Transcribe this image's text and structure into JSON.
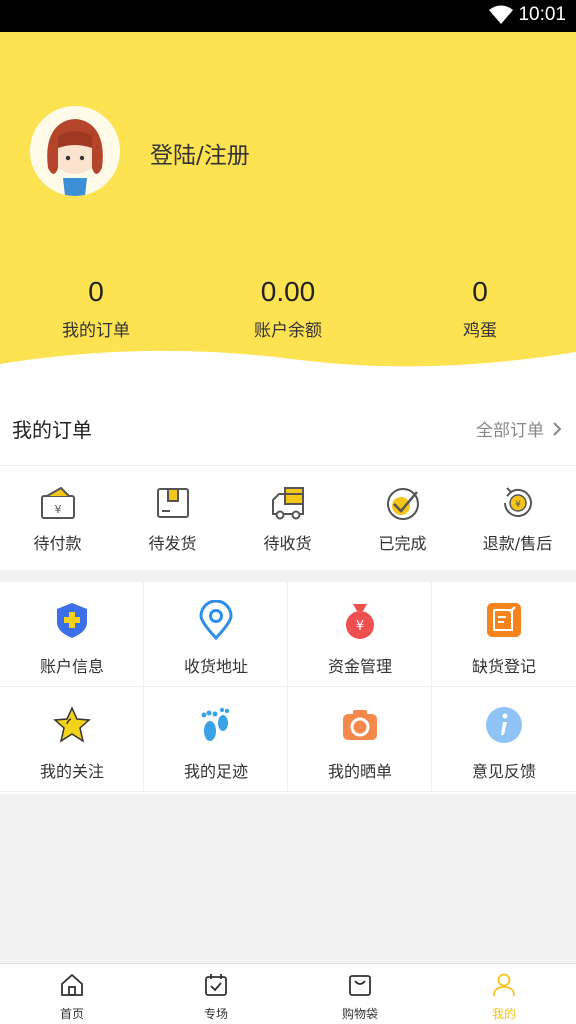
{
  "status_bar": {
    "time": "10:01"
  },
  "profile": {
    "login_label": "登陆/注册"
  },
  "stats": [
    {
      "value": "0",
      "label": "我的订单"
    },
    {
      "value": "0.00",
      "label": "账户余额"
    },
    {
      "value": "0",
      "label": "鸡蛋"
    }
  ],
  "orders": {
    "title": "我的订单",
    "all_label": "全部订单",
    "items": [
      {
        "label": "待付款",
        "icon": "wallet-yen-icon"
      },
      {
        "label": "待发货",
        "icon": "package-box-icon"
      },
      {
        "label": "待收货",
        "icon": "delivery-truck-icon"
      },
      {
        "label": "已完成",
        "icon": "check-circle-icon"
      },
      {
        "label": "退款/售后",
        "icon": "refund-yen-icon"
      }
    ]
  },
  "grid": [
    {
      "label": "账户信息",
      "icon": "shield-plus-icon",
      "color": "#3d6fe8"
    },
    {
      "label": "收货地址",
      "icon": "location-pin-icon",
      "color": "#2f8fe8"
    },
    {
      "label": "资金管理",
      "icon": "money-bag-icon",
      "color": "#ef4f4f"
    },
    {
      "label": "缺货登记",
      "icon": "edit-note-icon",
      "color": "#f5841f"
    },
    {
      "label": "我的关注",
      "icon": "star-icon",
      "color": "#f5d21a"
    },
    {
      "label": "我的足迹",
      "icon": "footprint-icon",
      "color": "#3aa3e8"
    },
    {
      "label": "我的晒单",
      "icon": "camera-icon",
      "color": "#f5884b"
    },
    {
      "label": "意见反馈",
      "icon": "info-icon",
      "color": "#8fc3f5"
    }
  ],
  "tabbar": [
    {
      "label": "首页",
      "icon": "home-icon"
    },
    {
      "label": "专场",
      "icon": "calendar-check-icon"
    },
    {
      "label": "购物袋",
      "icon": "shopping-bag-icon"
    },
    {
      "label": "我的",
      "icon": "person-icon",
      "active": true
    }
  ],
  "colors": {
    "accent": "#fde252",
    "active_tab": "#f5c518"
  }
}
